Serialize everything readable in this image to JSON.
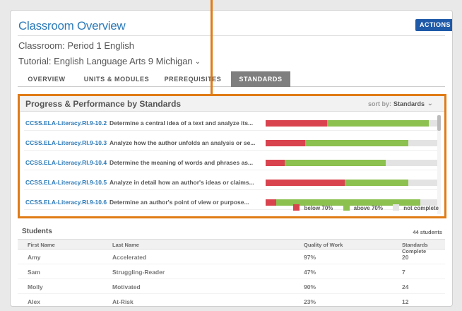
{
  "header": {
    "title": "Classroom Overview",
    "actions_label": "ACTIONS",
    "classroom": "Classroom: Period 1 English",
    "tutorial": "Tutorial: English Language Arts 9 Michigan"
  },
  "tabs": [
    {
      "label": "OVERVIEW",
      "active": false
    },
    {
      "label": "UNITS & MODULES",
      "active": false
    },
    {
      "label": "PREREQUISITES",
      "active": false
    },
    {
      "label": "STANDARDS",
      "active": true
    }
  ],
  "standards_panel": {
    "title": "Progress & Performance by Standards",
    "sort_label": "sort by:",
    "sort_value": "Standards",
    "rows": [
      {
        "code": "CCSS.ELA-Literacy.RI.9-10.2",
        "description": "Determine a central idea of a text and analyze its...",
        "below": 0.36,
        "above": 0.59
      },
      {
        "code": "CCSS.ELA-Literacy.RI.9-10.3",
        "description": "Analyze how the author unfolds an analysis or se...",
        "below": 0.23,
        "above": 0.6
      },
      {
        "code": "CCSS.ELA-Literacy.RI.9-10.4",
        "description": "Determine the meaning of words and phrases as...",
        "below": 0.11,
        "above": 0.59
      },
      {
        "code": "CCSS.ELA-Literacy.RI.9-10.5",
        "description": "Analyze in detail how an author's ideas or claims...",
        "below": 0.46,
        "above": 0.37
      },
      {
        "code": "CCSS.ELA-Literacy.RI.9-10.6",
        "description": "Determine an author's point of view or purpose...",
        "below": 0.06,
        "above": 0.84
      }
    ],
    "legend": [
      {
        "label": "below 70%",
        "color": "#d9434e"
      },
      {
        "label": "above 70%",
        "color": "#8cc04f"
      },
      {
        "label": "not complete",
        "color": "#e3e3e3"
      }
    ]
  },
  "students": {
    "title": "Students",
    "count": "44 students",
    "columns": [
      "First Name",
      "Last Name",
      "Quality of Work",
      "Standards Complete"
    ],
    "rows": [
      [
        "Amy",
        "Accelerated",
        "97%",
        "20"
      ],
      [
        "Sam",
        "Struggling-Reader",
        "47%",
        "7"
      ],
      [
        "Molly",
        "Motivated",
        "90%",
        "24"
      ],
      [
        "Alex",
        "At-Risk",
        "23%",
        "12"
      ]
    ]
  },
  "colors": {
    "accent": "#2c7ab8",
    "highlight": "#e07b16",
    "button": "#1f5aa8"
  }
}
